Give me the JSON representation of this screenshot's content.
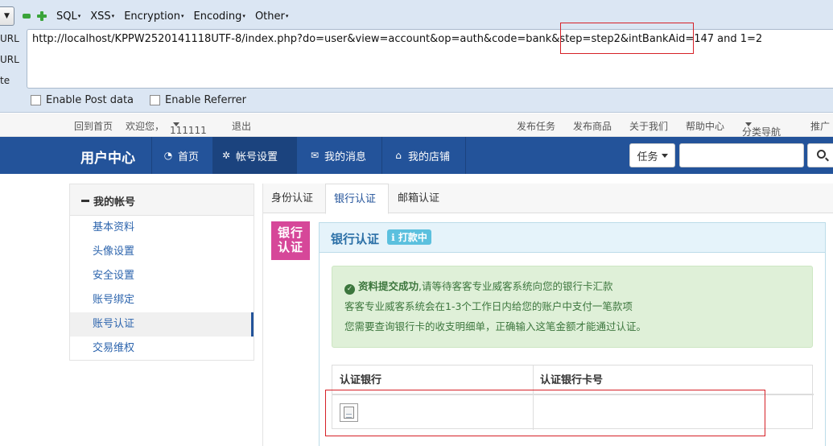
{
  "hackbar": {
    "menu": [
      "SQL",
      "XSS",
      "Encryption",
      "Encoding",
      "Other"
    ],
    "side_labels": [
      "URL",
      "URL",
      "te"
    ],
    "url": "http://localhost/KPPW2520141118UTF-8/index.php?do=user&view=account&op=auth&code=bank&step=step2&intBankAid=147 and 1=2",
    "enable_post": "Enable Post data",
    "enable_referrer": "Enable Referrer"
  },
  "topbar": {
    "home": "回到首页",
    "welcome": "欢迎您，",
    "username": "111111",
    "logout": "退出",
    "links": [
      "发布任务",
      "发布商品",
      "关于我们",
      "帮助中心",
      "分类导航",
      "推广"
    ]
  },
  "nav": {
    "brand": "用户中心",
    "items": [
      "首页",
      "帐号设置",
      "我的消息",
      "我的店铺"
    ],
    "task_label": "任务"
  },
  "sidebar": {
    "title": "我的帐号",
    "items": [
      "基本资料",
      "头像设置",
      "安全设置",
      "账号绑定",
      "账号认证",
      "交易维权"
    ],
    "active_index": 4
  },
  "tabs": [
    "身份认证",
    "银行认证",
    "邮箱认证"
  ],
  "panel": {
    "badge_line1": "银行",
    "badge_line2": "认证",
    "title": "银行认证",
    "status": "打款中",
    "alert_bold": "资料提交成功",
    "alert_line1_rest": ",请等待客客专业威客系统向您的银行卡汇款",
    "alert_line2": "客客专业威客系统会在1-3个工作日内给您的账户中支付一笔款项",
    "alert_line3": "您需要查询银行卡的收支明细单，正确输入这笔金额才能通过认证。",
    "col_bank": "认证银行",
    "col_card": "认证银行卡号"
  },
  "colors": {
    "navbar": "#23539a",
    "highlight": "#d62027",
    "badge": "#d64799",
    "alert_bg": "#dff0d8",
    "status": "#5bc0de"
  }
}
